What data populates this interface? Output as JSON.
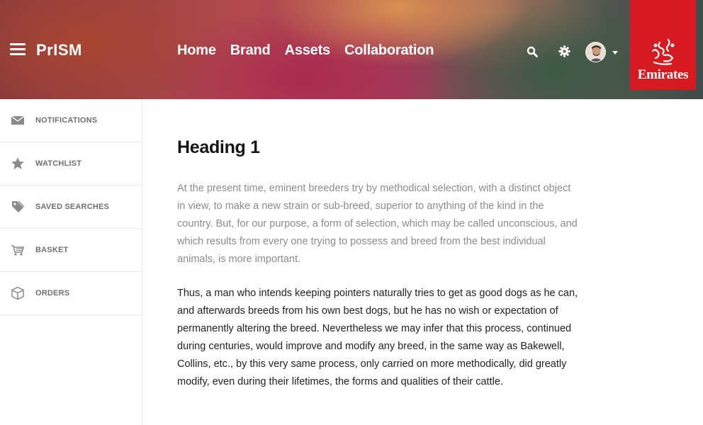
{
  "header": {
    "logo": "PrISM",
    "nav": [
      "Home",
      "Brand",
      "Assets",
      "Collaboration"
    ],
    "brand_name": "Emirates",
    "colors": {
      "brand_red": "#d71a21"
    }
  },
  "sidebar": {
    "items": [
      {
        "label": "NOTIFICATIONS",
        "icon": "envelope-icon"
      },
      {
        "label": "WATCHLIST",
        "icon": "star-icon"
      },
      {
        "label": "SAVED SEARCHES",
        "icon": "tag-icon"
      },
      {
        "label": "BASKET",
        "icon": "cart-icon"
      },
      {
        "label": "ORDERS",
        "icon": "box-icon"
      }
    ]
  },
  "main": {
    "heading": "Heading 1",
    "paragraph_1": "At the present time, eminent breeders try by methodical selection, with a distinct object in view, to make a new strain or sub-breed, superior to anything of the kind in the country. But, for our purpose, a form of selection, which may be called unconscious, and which results from every one trying to possess and breed from the best individual animals, is more important.",
    "paragraph_2": "Thus, a man who intends keeping pointers naturally tries to get as good dogs as he can, and afterwards breeds from his own best dogs, but he has no wish or expectation of permanently altering the breed. Nevertheless we may infer that this process, continued during centuries, would improve and modify any breed, in the same way as Bakewell, Collins, etc., by this very same process, only carried on more methodically, did greatly modify, even during their lifetimes, the forms and qualities of their cattle."
  }
}
